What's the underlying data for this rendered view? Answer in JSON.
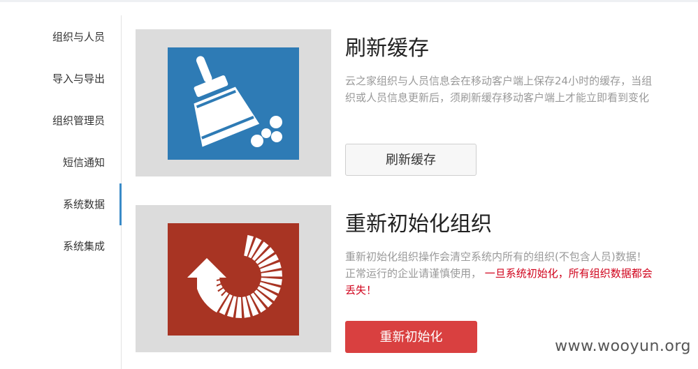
{
  "sidebar": {
    "items": [
      {
        "label": "组织与人员"
      },
      {
        "label": "导入与导出"
      },
      {
        "label": "组织管理员"
      },
      {
        "label": "短信通知"
      },
      {
        "label": "系统数据",
        "active": true
      },
      {
        "label": "系统集成"
      }
    ]
  },
  "cache_card": {
    "title": "刷新缓存",
    "description": "云之家组织与人员信息会在移动客户端上保存24小时的缓存，当组织或人员信息更新后，须刷新缓存移动客户端上才能立即看到变化",
    "button_label": "刷新缓存",
    "icon": "broom-icon",
    "icon_bg": "#2e7bb5"
  },
  "reinit_card": {
    "title": "重新初始化组织",
    "description": "重新初始化组织操作会清空系统内所有的组织(不包含人员)数据！正常运行的企业请谨慎使用，",
    "warning": "一旦系统初始化，所有组织数据都会丢失！",
    "button_label": "重新初始化",
    "icon": "reset-icon",
    "icon_bg": "#a83423"
  },
  "watermark": "www.wooyun.org",
  "colors": {
    "accent": "#3a8bc8",
    "danger_button": "#d94040",
    "warning_text": "#d0021b"
  }
}
